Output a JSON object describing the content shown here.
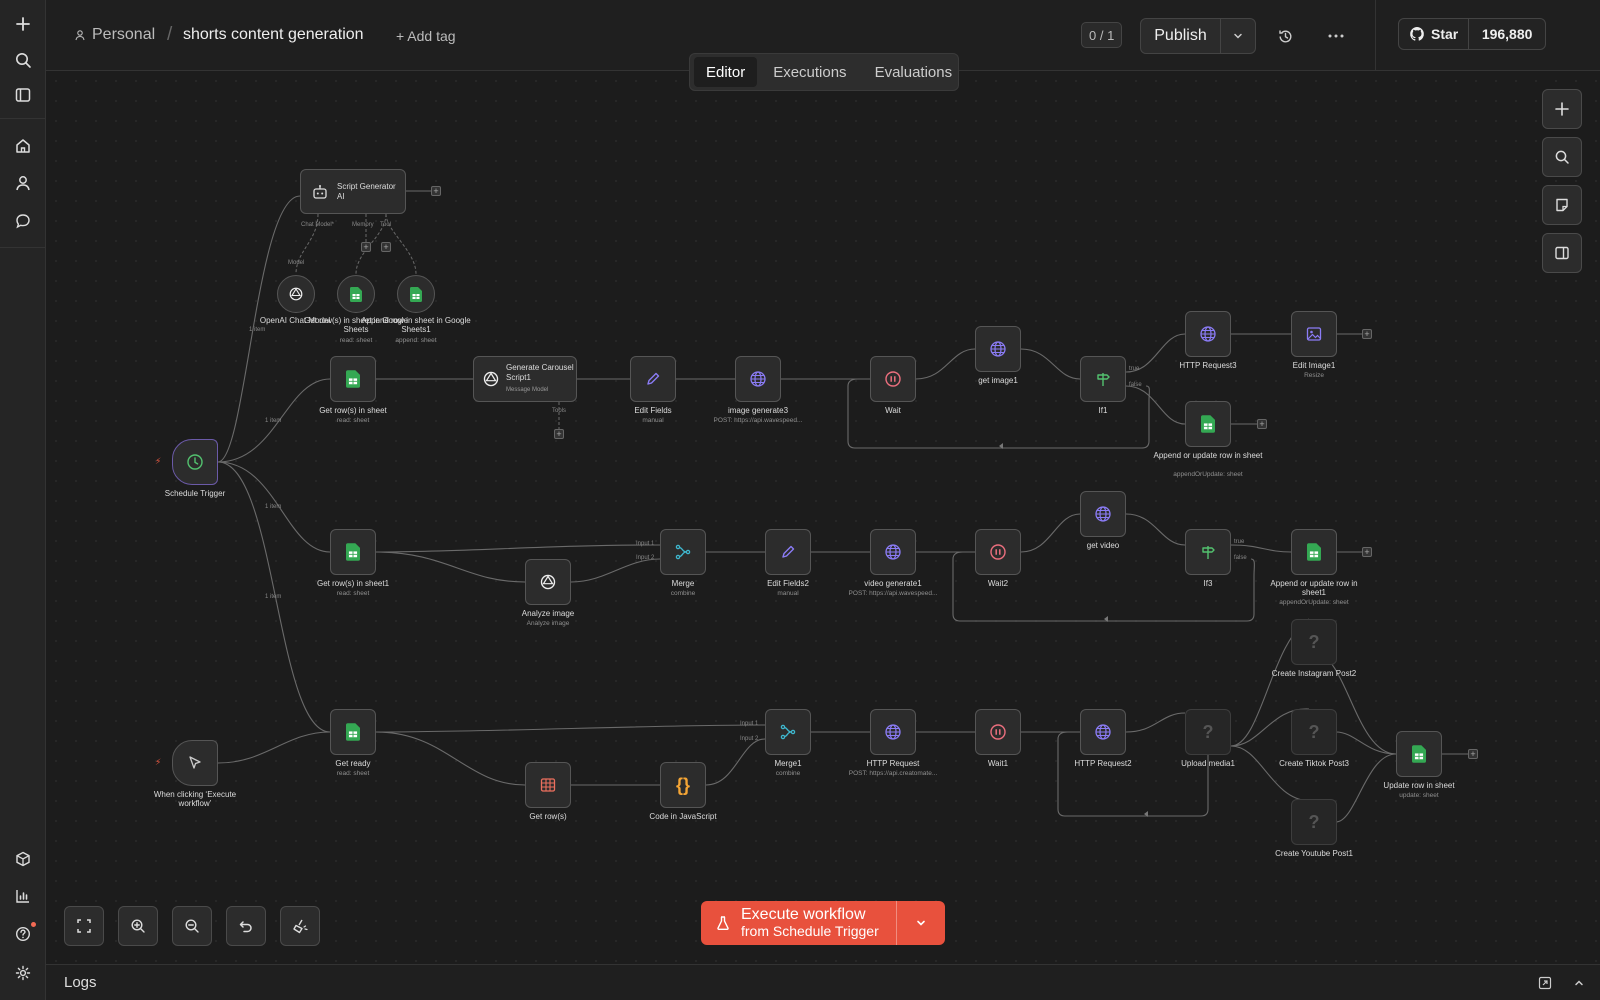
{
  "breadcrumb": {
    "owner": "Personal",
    "workflow_name": "shorts content generation",
    "add_tag": "+ Add tag"
  },
  "header": {
    "version": "0 / 1",
    "publish": "Publish",
    "github_star": "Star",
    "github_count": "196,880"
  },
  "tabs": [
    {
      "label": "Editor",
      "active": true
    },
    {
      "label": "Executions",
      "active": false
    },
    {
      "label": "Evaluations",
      "active": false
    }
  ],
  "execute": {
    "line1": "Execute workflow",
    "line2": "from Schedule Trigger"
  },
  "logs": {
    "label": "Logs"
  },
  "colors": {
    "accent": "#e8513d",
    "sheets": "#34a853",
    "http": "#8b7cf6",
    "wait": "#ec6f7e",
    "if": "#53c26f",
    "merge": "#3fb8cf",
    "code": "#f4a535"
  },
  "nodes": [
    {
      "id": "script-generator-ai",
      "label": "Script Generator AI",
      "sub": "",
      "icon": "robot"
    },
    {
      "id": "openai-chat-model",
      "label": "OpenAI Chat Model",
      "sub": "",
      "icon": "openai"
    },
    {
      "id": "get-rows-google-sheets",
      "label": "Get row(s) in sheet in Google Sheets",
      "sub": "read: sheet",
      "icon": "sheets"
    },
    {
      "id": "append-row-google-sheets1",
      "label": "Append row in sheet in Google Sheets1",
      "sub": "append: sheet",
      "icon": "sheets"
    },
    {
      "id": "get-rows-in-sheet",
      "label": "Get row(s) in sheet",
      "sub": "read: sheet",
      "icon": "sheets"
    },
    {
      "id": "generate-carousel-script1",
      "label": "Generate Carousel Script1",
      "sub": "Message Model",
      "icon": "openai"
    },
    {
      "id": "edit-fields",
      "label": "Edit Fields",
      "sub": "manual",
      "icon": "pencil"
    },
    {
      "id": "image-generate3",
      "label": "image generate3",
      "sub": "POST: https://api.wavespeed...",
      "icon": "globe"
    },
    {
      "id": "wait",
      "label": "Wait",
      "sub": "",
      "icon": "pause"
    },
    {
      "id": "get-image1",
      "label": "get image1",
      "sub": "",
      "icon": "globe"
    },
    {
      "id": "if1",
      "label": "If1",
      "sub": "",
      "icon": "if"
    },
    {
      "id": "http-request3",
      "label": "HTTP Request3",
      "sub": "",
      "icon": "globe"
    },
    {
      "id": "edit-image1",
      "label": "Edit Image1",
      "sub": "Resize",
      "icon": "image"
    },
    {
      "id": "append-update-row",
      "label": "Append or update row in sheet",
      "sub": "appendOrUpdate: sheet",
      "icon": "sheets"
    },
    {
      "id": "schedule-trigger",
      "label": "Schedule Trigger",
      "sub": "",
      "icon": "clock"
    },
    {
      "id": "get-rows-in-sheet1",
      "label": "Get row(s) in sheet1",
      "sub": "read: sheet",
      "icon": "sheets"
    },
    {
      "id": "analyze-image",
      "label": "Analyze image",
      "sub": "Analyze image",
      "icon": "openai"
    },
    {
      "id": "merge",
      "label": "Merge",
      "sub": "combine",
      "icon": "merge"
    },
    {
      "id": "edit-fields2",
      "label": "Edit Fields2",
      "sub": "manual",
      "icon": "pencil"
    },
    {
      "id": "video-generate1",
      "label": "video generate1",
      "sub": "POST: https://api.wavespeed...",
      "icon": "globe"
    },
    {
      "id": "wait2",
      "label": "Wait2",
      "sub": "",
      "icon": "pause"
    },
    {
      "id": "get-video",
      "label": "get video",
      "sub": "",
      "icon": "globe"
    },
    {
      "id": "if3",
      "label": "If3",
      "sub": "",
      "icon": "if"
    },
    {
      "id": "append-update-row1",
      "label": "Append or update row in sheet1",
      "sub": "appendOrUpdate: sheet",
      "icon": "sheets"
    },
    {
      "id": "create-instagram-post2",
      "label": "Create Instagram Post2",
      "sub": "",
      "icon": "unknown"
    },
    {
      "id": "manual-trigger",
      "label": "When clicking ‘Execute workflow’",
      "sub": "",
      "icon": "pointer"
    },
    {
      "id": "get-ready",
      "label": "Get ready",
      "sub": "read: sheet",
      "icon": "sheets"
    },
    {
      "id": "get-rows",
      "label": "Get row(s)",
      "sub": "",
      "icon": "table"
    },
    {
      "id": "code-in-javascript",
      "label": "Code in JavaScript",
      "sub": "",
      "icon": "code"
    },
    {
      "id": "merge1",
      "label": "Merge1",
      "sub": "combine",
      "icon": "merge"
    },
    {
      "id": "http-request",
      "label": "HTTP Request",
      "sub": "POST: https://api.creatomate...",
      "icon": "globe"
    },
    {
      "id": "wait1",
      "label": "Wait1",
      "sub": "",
      "icon": "pause"
    },
    {
      "id": "http-request2",
      "label": "HTTP Request2",
      "sub": "",
      "icon": "globe"
    },
    {
      "id": "upload-media1",
      "label": "Upload media1",
      "sub": "",
      "icon": "unknown"
    },
    {
      "id": "create-tiktok-post3",
      "label": "Create Tiktok Post3",
      "sub": "",
      "icon": "unknown"
    },
    {
      "id": "create-youtube-post1",
      "label": "Create Youtube Post1",
      "sub": "",
      "icon": "unknown"
    },
    {
      "id": "update-row-in-sheet",
      "label": "Update row in sheet",
      "sub": "update: sheet",
      "icon": "sheets"
    }
  ],
  "edge_labels": {
    "chat_model": "Chat Model*",
    "memory": "Memory",
    "tool": "Tool",
    "model": "Model",
    "tools": "Tools",
    "one_item": "1 item",
    "input1": "Input 1",
    "input2": "Input 2",
    "true": "true",
    "false": "false"
  }
}
